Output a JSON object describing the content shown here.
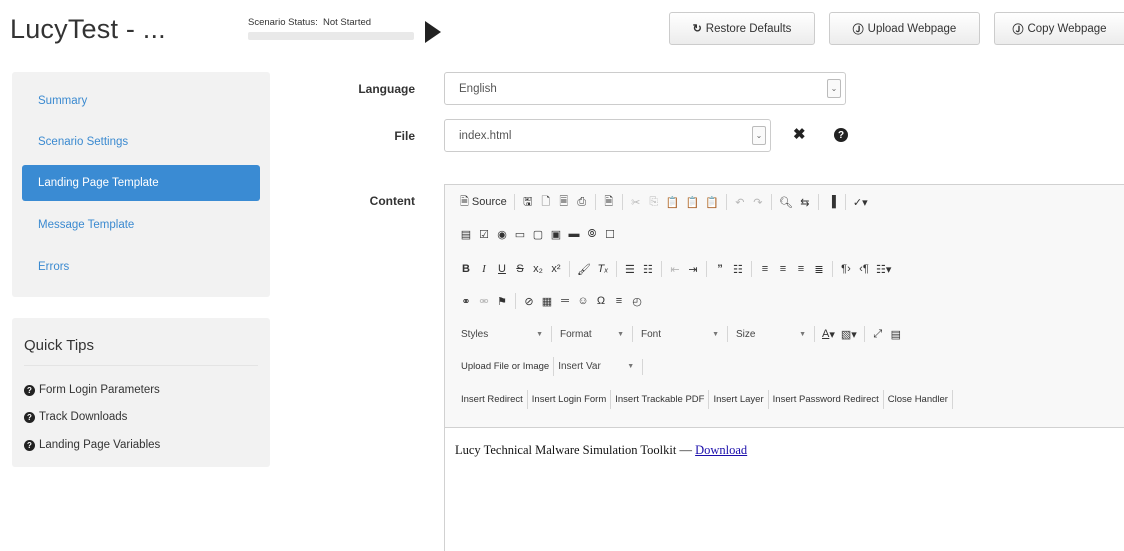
{
  "header": {
    "title": "LucyTest - ...",
    "status_label": "Scenario Status:",
    "status_value": "Not Started",
    "restore_label": "Restore Defaults",
    "upload_label": "Upload Webpage",
    "copy_label": "Copy Webpage"
  },
  "icons": {
    "restore": "refresh-icon",
    "upload": "circle-arrow-icon",
    "copy": "circle-arrow-icon",
    "play": "play-icon",
    "help": "question-circle-icon",
    "close": "x-icon"
  },
  "colors": {
    "accent": "#3a8bd3",
    "link": "#3b8ad0",
    "panel": "#f2f2f2"
  },
  "sidebar": {
    "items": [
      {
        "label": "Summary",
        "active": false
      },
      {
        "label": "Scenario Settings",
        "active": false
      },
      {
        "label": "Landing Page Template",
        "active": true
      },
      {
        "label": "Message Template",
        "active": false
      },
      {
        "label": "Errors",
        "active": false
      }
    ]
  },
  "tips": {
    "title": "Quick Tips",
    "items": [
      "Form Login Parameters",
      "Track Downloads",
      "Landing Page Variables"
    ]
  },
  "form": {
    "language_label": "Language",
    "language_value": "English",
    "file_label": "File",
    "file_value": "index.html",
    "content_label": "Content"
  },
  "editor": {
    "source_label": "Source",
    "styles_label": "Styles",
    "format_label": "Format",
    "font_label": "Font",
    "size_label": "Size",
    "upload_file_label": "Upload File or Image",
    "insert_var_label": "Insert Var",
    "insert_buttons": [
      "Insert Redirect",
      "Insert Login Form",
      "Insert Trackable PDF",
      "Insert Layer",
      "Insert Password Redirect",
      "Close Handler"
    ],
    "content_text": "Lucy Technical Malware Simulation Toolkit — ",
    "content_link": "Download"
  }
}
